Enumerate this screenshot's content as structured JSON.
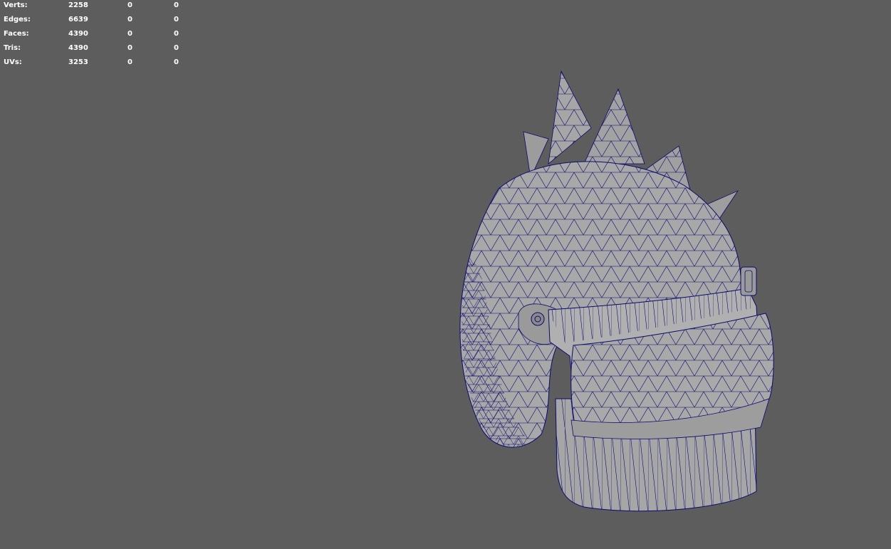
{
  "hud": {
    "rows": [
      {
        "label": "Verts:",
        "v1": "2258",
        "v2": "0",
        "v3": "0"
      },
      {
        "label": "Edges:",
        "v1": "6639",
        "v2": "0",
        "v3": "0"
      },
      {
        "label": "Faces:",
        "v1": "4390",
        "v2": "0",
        "v3": "0"
      },
      {
        "label": "Tris:",
        "v1": "4390",
        "v2": "0",
        "v3": "0"
      },
      {
        "label": "UVs:",
        "v1": "3253",
        "v2": "0",
        "v3": "0"
      }
    ]
  },
  "colors": {
    "background": "#5d5d5d",
    "mesh_fill": "#a4a4a4",
    "mesh_fill_dark": "#8e8e8e",
    "wire": "#0a0a6e",
    "hud_text": "#ffffff"
  }
}
